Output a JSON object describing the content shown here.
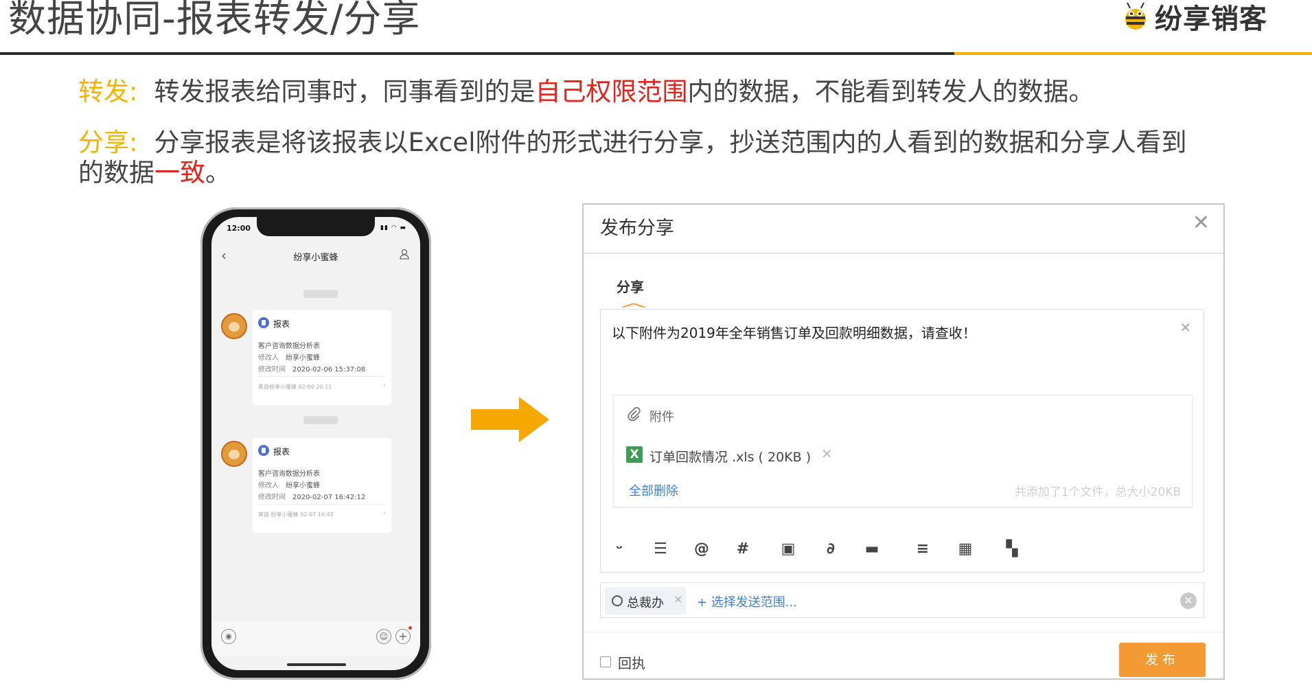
{
  "slide": {
    "title": "数据协同-报表转发/分享",
    "logo_text": "纷享销客"
  },
  "paragraphs": {
    "forward": {
      "label": "转发",
      "colon": ":",
      "text_1": "转发报表给同事时，同事看到的是",
      "highlight": "自己权限范围",
      "text_2": "内的数据，不能看到转发人的数据。"
    },
    "share": {
      "label": "分享",
      "colon": ":",
      "text_1": "分享报表是将该报表以Excel附件的形式进行分享，抄送范围内的人看到的数据和分享人看到",
      "text_2": "的数据",
      "highlight": "一致",
      "text_3": "。"
    }
  },
  "phone": {
    "status_time": "12:00",
    "nav_title": "纷享小蜜蜂",
    "cards": [
      {
        "type": "报表",
        "name": "客户咨询数据分析表",
        "modifier_label": "修改人",
        "modifier": "纷享小蜜蜂",
        "time_label": "修改时间",
        "time": "2020-02-06 15:37:08",
        "footer": "来自纷享小蜜蜂 02-06 20:11"
      },
      {
        "type": "报表",
        "name": "客户咨询数据分析表",
        "modifier_label": "修改人",
        "modifier": "纷享小蜜蜂",
        "time_label": "修改时间",
        "time": "2020-02-07 16:42:12",
        "footer": "来自 纷享小蜜蜂 02-07 16:42"
      }
    ]
  },
  "dialog": {
    "title": "发布分享",
    "tab": "分享",
    "message": "以下附件为2019年全年销售订单及回款明细数据，请查收！",
    "attachments_label": "附件",
    "file_name": "订单回款情况 .xls ( 20KB )",
    "delete_all": "全部删除",
    "summary": "共添加了1个文件，总大小20KB",
    "toolbar_icons": [
      "emoji-icon",
      "list-icon",
      "mention-icon",
      "hashtag-icon",
      "image-icon",
      "attachment-icon",
      "card-icon",
      "align-icon",
      "table-icon",
      "apps-icon"
    ],
    "scope_tag": "总裁办",
    "select_scope": "+ 选择发送范围...",
    "receipt_label": "回执",
    "publish_button": "发布"
  },
  "colors": {
    "accent_gold": "#f4b400",
    "highlight_red": "#e0231b",
    "publish_orange": "#f39a35",
    "link_blue": "#3d7fd8",
    "excel_green": "#3f9b56"
  }
}
